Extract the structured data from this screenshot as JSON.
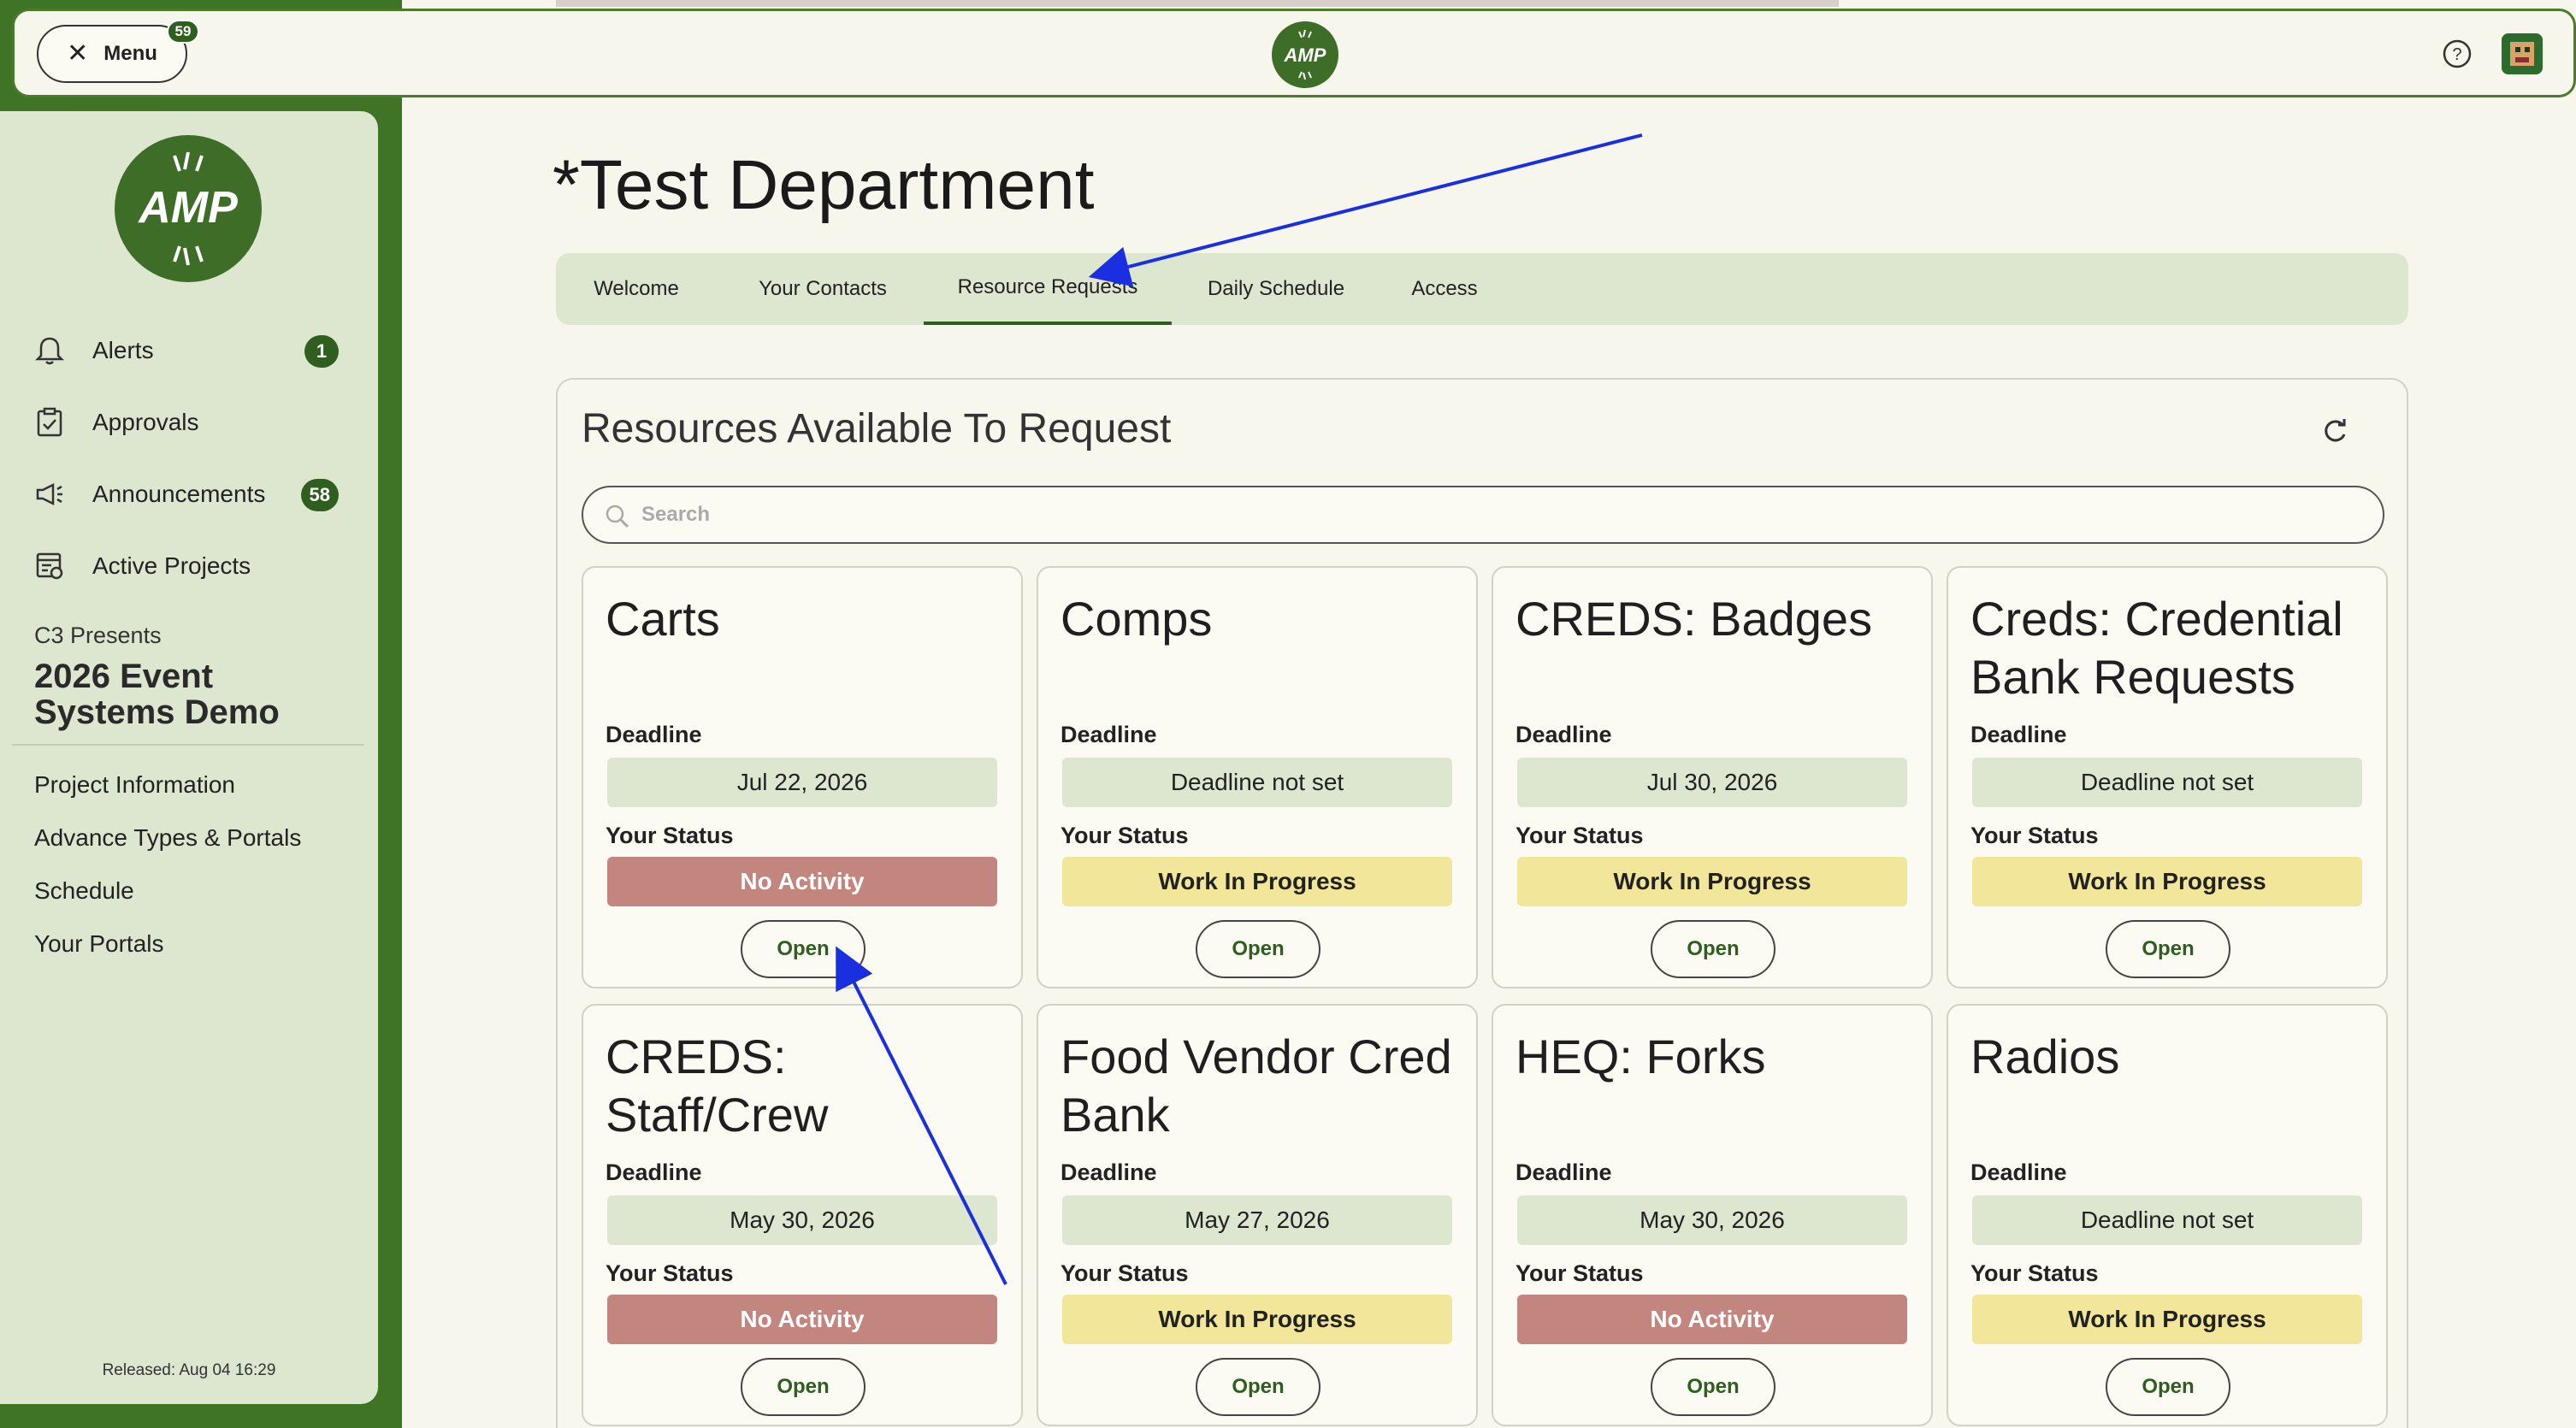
{
  "topbar": {
    "menu_label": "Menu",
    "menu_badge": "59",
    "logo_text": "AMP",
    "icons": {
      "close": "close-icon",
      "help": "help-circle-icon",
      "avatar": "user-avatar"
    }
  },
  "sidebar": {
    "logo_text": "AMP",
    "nav": [
      {
        "label": "Alerts",
        "icon": "bell-icon",
        "count": "1"
      },
      {
        "label": "Approvals",
        "icon": "clipboard-check-icon",
        "count": ""
      },
      {
        "label": "Announcements",
        "icon": "megaphone-icon",
        "count": "58"
      },
      {
        "label": "Active Projects",
        "icon": "project-board-icon",
        "count": ""
      }
    ],
    "presents": "C3 Presents",
    "project_title": "2026 Event Systems Demo",
    "links": [
      "Project Information",
      "Advance Types & Portals",
      "Schedule",
      "Your Portals"
    ],
    "released": "Released: Aug 04 16:29"
  },
  "main": {
    "title": "*Test Department",
    "tabs": [
      "Welcome",
      "Your Contacts",
      "Resource Requests",
      "Daily Schedule",
      "Access"
    ],
    "active_tab": "Resource Requests",
    "panel_title": "Resources Available To Request",
    "search_placeholder": "Search",
    "deadline_label": "Deadline",
    "status_label": "Your Status",
    "open_label": "Open",
    "cards": [
      {
        "name": "Carts",
        "deadline": "Jul 22, 2026",
        "status": "No Activity",
        "status_color": "#c2867f"
      },
      {
        "name": "Comps",
        "deadline": "Deadline not set",
        "status": "Work In Progress",
        "status_color": "#f1e69a"
      },
      {
        "name": "CREDS: Badges",
        "deadline": "Jul 30, 2026",
        "status": "Work In Progress",
        "status_color": "#f1e69a"
      },
      {
        "name": "Creds: Credential Bank Requests",
        "deadline": "Deadline not set",
        "status": "Work In Progress",
        "status_color": "#f1e69a"
      },
      {
        "name": "CREDS: Staff/Crew",
        "deadline": "May 30, 2026",
        "status": "No Activity",
        "status_color": "#c2867f"
      },
      {
        "name": "Food Vendor Cred Bank",
        "deadline": "May 27, 2026",
        "status": "Work In Progress",
        "status_color": "#f1e69a"
      },
      {
        "name": "HEQ: Forks",
        "deadline": "May 30, 2026",
        "status": "No Activity",
        "status_color": "#c2867f"
      },
      {
        "name": "Radios",
        "deadline": "Deadline not set",
        "status": "Work In Progress",
        "status_color": "#f1e69a"
      }
    ]
  },
  "colors": {
    "brand": "#3d6d26",
    "accent": "#2f5f1e",
    "annotation": "#1a2fe0"
  }
}
